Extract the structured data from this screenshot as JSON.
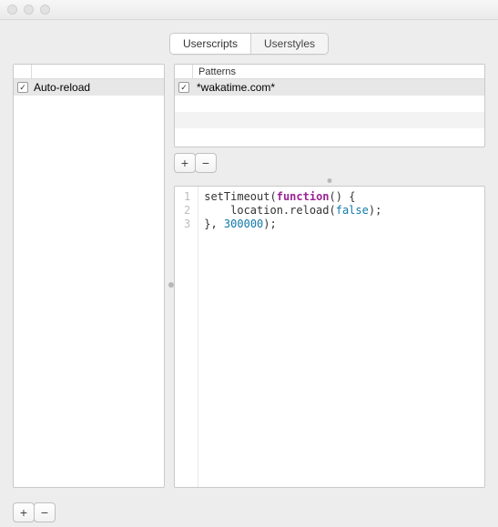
{
  "tabs": {
    "userscripts": "Userscripts",
    "userstyles": "Userstyles",
    "active": 0
  },
  "scripts": {
    "items": [
      {
        "enabled": true,
        "name": "Auto-reload"
      }
    ]
  },
  "patterns": {
    "header": "Patterns",
    "items": [
      {
        "enabled": true,
        "pattern": "*wakatime.com*"
      }
    ]
  },
  "code": {
    "line1_a": "setTimeout",
    "line1_b": "function",
    "line1_c": "() {",
    "line2_a": "    location.reload(",
    "line2_b": "false",
    "line2_c": ");",
    "line3_a": "}, ",
    "line3_b": "300000",
    "line3_c": ");"
  },
  "glyphs": {
    "plus": "+",
    "minus": "−",
    "check": "✓"
  },
  "lineNumbers": [
    "1",
    "2",
    "3"
  ]
}
